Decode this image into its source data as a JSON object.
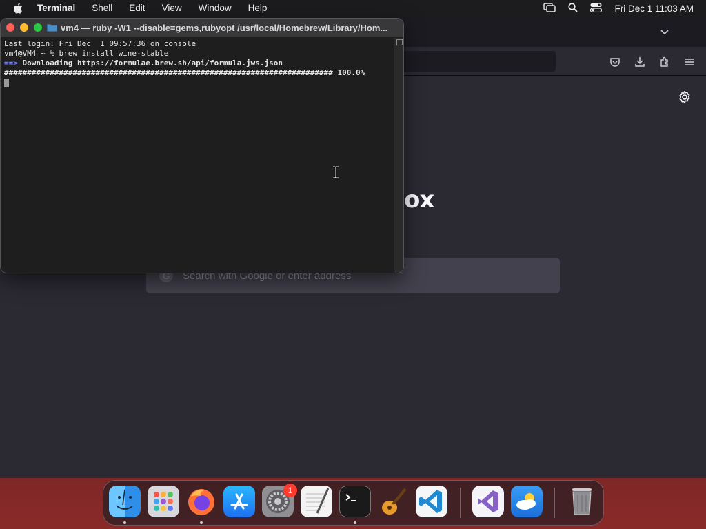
{
  "menubar": {
    "app_name": "Terminal",
    "items": [
      "Shell",
      "Edit",
      "View",
      "Window",
      "Help"
    ],
    "clock": "Fri Dec 1  11:03 AM",
    "icons": [
      "apple-icon",
      "screen-mirroring-icon",
      "spotlight-search-icon",
      "control-center-icon"
    ]
  },
  "firefox": {
    "brand_partial": "ox",
    "search_placeholder": "Search with Google or enter address",
    "accent": "#2b2a33"
  },
  "terminal": {
    "title": "vm4 — ruby -W1 --disable=gems,rubyopt /usr/local/Homebrew/Library/Hom...",
    "lines": {
      "login": "Last login: Fri Dec  1 09:57:36 on console",
      "prompt": "vm4@VM4 ~ % brew install wine-stable",
      "arrow": "==>",
      "downloading": " Downloading https://formulae.brew.sh/api/formula.jws.json",
      "progress_bar": "########################################################################",
      "progress_pct": " 100.0%"
    },
    "progress": 1.0
  },
  "dock": {
    "apps": [
      "Finder",
      "Launchpad",
      "Firefox",
      "App Store",
      "System Settings",
      "TextEdit",
      "Terminal",
      "GarageBand",
      "Visual Studio Code",
      "Visual Studio",
      "Weather",
      "Trash"
    ],
    "settings_badge": "1",
    "running": [
      "Finder",
      "Firefox",
      "Terminal"
    ]
  }
}
